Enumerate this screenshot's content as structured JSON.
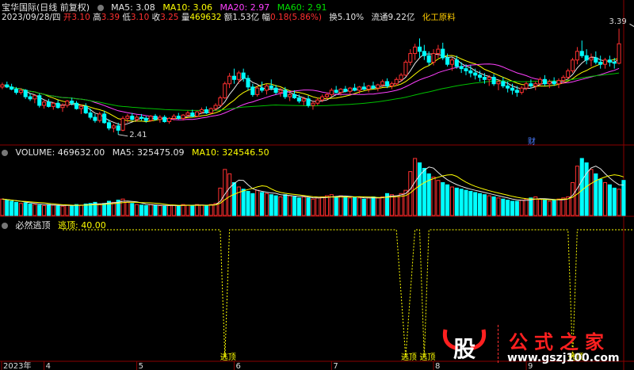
{
  "header": {
    "stock_title": "宝华国际(日线 前复权)",
    "ma5": "MA5: 3.08",
    "ma10": "MA10: 3.06",
    "ma20": "MA20: 2.97",
    "ma60": "MA60: 2.91"
  },
  "info": {
    "date": "2023/09/28/四",
    "open_label": "开",
    "open": "3.10",
    "high_label": "高",
    "high": "3.39",
    "low_label": "低",
    "low": "3.10",
    "close_label": "收",
    "close": "3.25",
    "vol_label": "量",
    "vol": "469632",
    "amount_label": "额",
    "amount": "1.53亿",
    "chg_label": "幅",
    "chg": "0.18(5.86%)",
    "turnover": "换5.10%",
    "float": "流通9.22亿",
    "industry": "化工原料"
  },
  "volume_header": {
    "volume": "VOLUME: 469632.00",
    "ma5": "MA5: 325475.09",
    "ma10": "MA10: 324546.50"
  },
  "indicator_header": {
    "name": "必然逃顶",
    "value": "逃顶: 40.00"
  },
  "watermark": {
    "logo_text": "股",
    "brand": "公式之家",
    "url": "www.gszj100.com"
  },
  "colors": {
    "up": "#ff3030",
    "down": "#00ffff",
    "ma5": "#e6e6e6",
    "ma10": "#ffff00",
    "ma20": "#ff40ff",
    "ma60": "#00c000",
    "signal": "#ffff00",
    "grid": "#8b0000"
  },
  "chart_data": [
    {
      "type": "candlestick",
      "title": "宝华国际(日线 前复权)",
      "annotations": [
        {
          "label": "2.41",
          "x_index": 25,
          "y": 2.41
        },
        {
          "label": "3.39",
          "x_index": 137,
          "y": 3.39
        },
        {
          "label": "财",
          "x_index": 114
        }
      ],
      "x_tick_labels": [
        "2023年",
        "4",
        "5",
        "6",
        "7",
        "8",
        "9"
      ],
      "x_tick_index": [
        0,
        9,
        29,
        50,
        71,
        93,
        113
      ],
      "ylim": [
        2.35,
        3.45
      ],
      "series_ma": [
        "MA5",
        "MA10",
        "MA20",
        "MA60"
      ],
      "bars": [
        [
          2.85,
          2.89,
          2.83,
          2.87
        ],
        [
          2.87,
          2.9,
          2.84,
          2.85
        ],
        [
          2.85,
          2.88,
          2.82,
          2.83
        ],
        [
          2.83,
          2.85,
          2.78,
          2.8
        ],
        [
          2.8,
          2.84,
          2.78,
          2.82
        ],
        [
          2.82,
          2.83,
          2.74,
          2.76
        ],
        [
          2.76,
          2.79,
          2.72,
          2.74
        ],
        [
          2.74,
          2.78,
          2.7,
          2.77
        ],
        [
          2.77,
          2.79,
          2.66,
          2.68
        ],
        [
          2.68,
          2.73,
          2.65,
          2.71
        ],
        [
          2.71,
          2.74,
          2.66,
          2.67
        ],
        [
          2.67,
          2.71,
          2.64,
          2.7
        ],
        [
          2.7,
          2.73,
          2.65,
          2.66
        ],
        [
          2.66,
          2.7,
          2.62,
          2.68
        ],
        [
          2.68,
          2.73,
          2.66,
          2.72
        ],
        [
          2.72,
          2.75,
          2.68,
          2.7
        ],
        [
          2.7,
          2.72,
          2.64,
          2.65
        ],
        [
          2.65,
          2.69,
          2.6,
          2.67
        ],
        [
          2.67,
          2.7,
          2.6,
          2.61
        ],
        [
          2.61,
          2.65,
          2.55,
          2.57
        ],
        [
          2.57,
          2.6,
          2.52,
          2.54
        ],
        [
          2.54,
          2.62,
          2.52,
          2.6
        ],
        [
          2.6,
          2.63,
          2.51,
          2.52
        ],
        [
          2.52,
          2.55,
          2.45,
          2.47
        ],
        [
          2.47,
          2.51,
          2.43,
          2.49
        ],
        [
          2.49,
          2.52,
          2.41,
          2.45
        ],
        [
          2.45,
          2.58,
          2.44,
          2.56
        ],
        [
          2.56,
          2.6,
          2.52,
          2.58
        ],
        [
          2.58,
          2.61,
          2.54,
          2.55
        ],
        [
          2.55,
          2.59,
          2.53,
          2.57
        ],
        [
          2.57,
          2.6,
          2.54,
          2.56
        ],
        [
          2.56,
          2.58,
          2.52,
          2.54
        ],
        [
          2.54,
          2.59,
          2.53,
          2.58
        ],
        [
          2.58,
          2.6,
          2.54,
          2.55
        ],
        [
          2.55,
          2.59,
          2.52,
          2.57
        ],
        [
          2.57,
          2.59,
          2.52,
          2.53
        ],
        [
          2.53,
          2.57,
          2.51,
          2.56
        ],
        [
          2.56,
          2.6,
          2.54,
          2.58
        ],
        [
          2.58,
          2.61,
          2.55,
          2.56
        ],
        [
          2.56,
          2.6,
          2.54,
          2.59
        ],
        [
          2.59,
          2.63,
          2.57,
          2.61
        ],
        [
          2.61,
          2.64,
          2.57,
          2.58
        ],
        [
          2.58,
          2.63,
          2.57,
          2.62
        ],
        [
          2.62,
          2.66,
          2.6,
          2.64
        ],
        [
          2.64,
          2.67,
          2.6,
          2.61
        ],
        [
          2.61,
          2.66,
          2.6,
          2.65
        ],
        [
          2.65,
          2.7,
          2.63,
          2.68
        ],
        [
          2.68,
          2.77,
          2.67,
          2.75
        ],
        [
          2.75,
          2.9,
          2.74,
          2.88
        ],
        [
          2.88,
          2.98,
          2.84,
          2.95
        ],
        [
          2.95,
          3.02,
          2.88,
          2.92
        ],
        [
          2.92,
          3.0,
          2.88,
          2.98
        ],
        [
          2.98,
          3.02,
          2.9,
          2.93
        ],
        [
          2.93,
          2.96,
          2.82,
          2.85
        ],
        [
          2.85,
          2.88,
          2.76,
          2.78
        ],
        [
          2.78,
          2.86,
          2.76,
          2.84
        ],
        [
          2.84,
          2.9,
          2.8,
          2.82
        ],
        [
          2.82,
          2.88,
          2.78,
          2.86
        ],
        [
          2.86,
          2.92,
          2.82,
          2.84
        ],
        [
          2.84,
          2.87,
          2.78,
          2.8
        ],
        [
          2.8,
          2.84,
          2.76,
          2.82
        ],
        [
          2.82,
          2.85,
          2.74,
          2.76
        ],
        [
          2.76,
          2.8,
          2.72,
          2.78
        ],
        [
          2.78,
          2.82,
          2.74,
          2.75
        ],
        [
          2.75,
          2.78,
          2.7,
          2.72
        ],
        [
          2.72,
          2.76,
          2.68,
          2.74
        ],
        [
          2.74,
          2.77,
          2.66,
          2.68
        ],
        [
          2.68,
          2.72,
          2.64,
          2.7
        ],
        [
          2.7,
          2.75,
          2.68,
          2.73
        ],
        [
          2.73,
          2.78,
          2.71,
          2.76
        ],
        [
          2.76,
          2.8,
          2.73,
          2.78
        ],
        [
          2.78,
          2.84,
          2.76,
          2.82
        ],
        [
          2.82,
          2.86,
          2.79,
          2.8
        ],
        [
          2.8,
          2.84,
          2.77,
          2.83
        ],
        [
          2.83,
          2.86,
          2.8,
          2.81
        ],
        [
          2.81,
          2.85,
          2.78,
          2.84
        ],
        [
          2.84,
          2.88,
          2.81,
          2.82
        ],
        [
          2.82,
          2.86,
          2.79,
          2.85
        ],
        [
          2.85,
          2.89,
          2.82,
          2.83
        ],
        [
          2.83,
          2.87,
          2.8,
          2.86
        ],
        [
          2.86,
          2.9,
          2.83,
          2.84
        ],
        [
          2.84,
          2.88,
          2.81,
          2.87
        ],
        [
          2.87,
          2.92,
          2.85,
          2.9
        ],
        [
          2.9,
          2.93,
          2.84,
          2.86
        ],
        [
          2.86,
          2.9,
          2.83,
          2.88
        ],
        [
          2.88,
          2.94,
          2.86,
          2.92
        ],
        [
          2.92,
          2.98,
          2.9,
          2.96
        ],
        [
          2.96,
          3.1,
          2.95,
          3.08
        ],
        [
          3.08,
          3.2,
          3.05,
          3.16
        ],
        [
          3.16,
          3.25,
          3.1,
          3.22
        ],
        [
          3.22,
          3.3,
          3.12,
          3.18
        ],
        [
          3.18,
          3.24,
          3.1,
          3.14
        ],
        [
          3.14,
          3.18,
          3.05,
          3.08
        ],
        [
          3.08,
          3.2,
          3.05,
          3.16
        ],
        [
          3.16,
          3.24,
          3.12,
          3.2
        ],
        [
          3.2,
          3.26,
          3.1,
          3.12
        ],
        [
          3.12,
          3.16,
          3.04,
          3.06
        ],
        [
          3.06,
          3.12,
          3.0,
          3.1
        ],
        [
          3.1,
          3.14,
          3.02,
          3.04
        ],
        [
          3.04,
          3.08,
          2.98,
          3.02
        ],
        [
          3.02,
          3.06,
          2.96,
          3.0
        ],
        [
          3.0,
          3.05,
          2.94,
          2.98
        ],
        [
          2.98,
          3.02,
          2.92,
          2.96
        ],
        [
          2.96,
          3.0,
          2.9,
          2.94
        ],
        [
          2.94,
          2.98,
          2.88,
          2.92
        ],
        [
          2.92,
          2.96,
          2.86,
          2.94
        ],
        [
          2.94,
          2.97,
          2.86,
          2.88
        ],
        [
          2.88,
          2.92,
          2.82,
          2.9
        ],
        [
          2.9,
          2.94,
          2.84,
          2.86
        ],
        [
          2.86,
          2.9,
          2.8,
          2.84
        ],
        [
          2.84,
          2.88,
          2.78,
          2.82
        ],
        [
          2.82,
          2.86,
          2.76,
          2.8
        ],
        [
          2.8,
          2.86,
          2.78,
          2.84
        ],
        [
          2.84,
          2.9,
          2.82,
          2.88
        ],
        [
          2.88,
          2.92,
          2.84,
          2.86
        ],
        [
          2.86,
          2.9,
          2.82,
          2.88
        ],
        [
          2.88,
          2.94,
          2.86,
          2.92
        ],
        [
          2.92,
          2.96,
          2.86,
          2.88
        ],
        [
          2.88,
          2.92,
          2.84,
          2.9
        ],
        [
          2.9,
          2.94,
          2.86,
          2.88
        ],
        [
          2.88,
          2.93,
          2.84,
          2.91
        ],
        [
          2.91,
          2.96,
          2.88,
          2.94
        ],
        [
          2.94,
          3.02,
          2.92,
          3.0
        ],
        [
          3.0,
          3.12,
          2.98,
          3.1
        ],
        [
          3.1,
          3.22,
          3.06,
          3.18
        ],
        [
          3.18,
          3.28,
          3.12,
          3.14
        ],
        [
          3.14,
          3.2,
          3.06,
          3.1
        ],
        [
          3.1,
          3.16,
          3.04,
          3.12
        ],
        [
          3.12,
          3.18,
          3.06,
          3.08
        ],
        [
          3.08,
          3.14,
          3.02,
          3.06
        ],
        [
          3.06,
          3.12,
          3.02,
          3.1
        ],
        [
          3.1,
          3.14,
          3.04,
          3.08
        ],
        [
          3.08,
          3.12,
          3.02,
          3.07
        ],
        [
          3.07,
          3.39,
          3.06,
          3.25
        ]
      ]
    },
    {
      "type": "bar",
      "title": "VOLUME",
      "values": [
        150,
        140,
        130,
        120,
        110,
        115,
        105,
        100,
        95,
        90,
        100,
        95,
        90,
        85,
        95,
        90,
        100,
        95,
        105,
        110,
        120,
        100,
        110,
        130,
        120,
        140,
        150,
        120,
        110,
        100,
        95,
        90,
        100,
        95,
        90,
        85,
        90,
        95,
        90,
        100,
        95,
        90,
        100,
        95,
        90,
        100,
        110,
        250,
        420,
        380,
        300,
        260,
        240,
        220,
        200,
        230,
        210,
        200,
        190,
        180,
        170,
        190,
        180,
        170,
        160,
        170,
        160,
        150,
        160,
        170,
        180,
        190,
        170,
        180,
        170,
        160,
        170,
        160,
        150,
        160,
        170,
        160,
        170,
        200,
        190,
        180,
        200,
        230,
        400,
        520,
        480,
        430,
        380,
        350,
        320,
        300,
        280,
        260,
        250,
        240,
        230,
        220,
        210,
        200,
        190,
        180,
        170,
        160,
        150,
        140,
        130,
        130,
        140,
        150,
        160,
        170,
        150,
        140,
        130,
        140,
        150,
        160,
        170,
        300,
        450,
        520,
        480,
        420,
        380,
        330,
        300,
        280,
        250,
        240,
        320
      ]
    },
    {
      "type": "line",
      "title": "必然逃顶",
      "name": "逃顶",
      "signal_label": "逃顶",
      "high": 40,
      "low": 0,
      "drops": [
        [
          47,
          49
        ],
        [
          85,
          89
        ],
        [
          90,
          92
        ],
        [
          122,
          124
        ],
        [
          137,
          138
        ]
      ]
    }
  ]
}
